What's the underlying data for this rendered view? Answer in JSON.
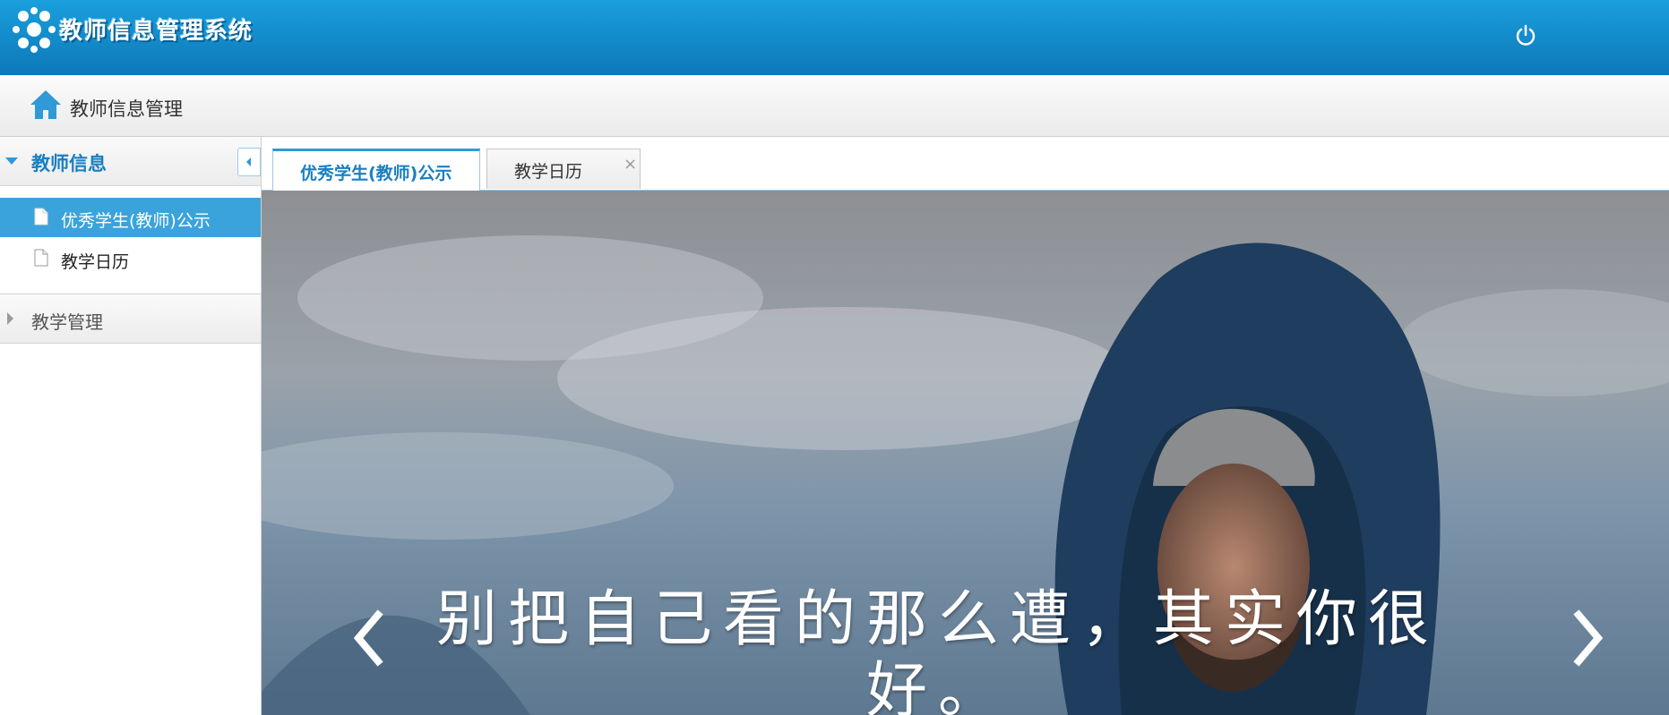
{
  "header": {
    "app_title": "教师信息管理系统",
    "logo_icon": "logo-icon",
    "logout_icon": "power-icon",
    "brand_color": "#1586c8"
  },
  "breadcrumb": {
    "icon": "home-icon",
    "label": "教师信息管理"
  },
  "sidebar": {
    "sections": [
      {
        "title": "教师信息",
        "expanded": true,
        "items": [
          {
            "label": "优秀学生(教师)公示",
            "icon": "document-icon",
            "selected": true
          },
          {
            "label": "教学日历",
            "icon": "document-icon",
            "selected": false
          }
        ]
      },
      {
        "title": "教学管理",
        "expanded": false,
        "items": []
      }
    ],
    "collapse_icon": "collapse-left-icon",
    "selected_color": "#3aa3dc"
  },
  "tabs": [
    {
      "label": "优秀学生(教师)公示",
      "active": true,
      "closable": false
    },
    {
      "label": "教学日历",
      "active": false,
      "closable": true,
      "close_symbol": "×"
    }
  ],
  "carousel": {
    "caption": "别把自己看的那么遭，其实你很好。",
    "prev_icon": "chevron-left-icon",
    "next_icon": "chevron-right-icon"
  }
}
